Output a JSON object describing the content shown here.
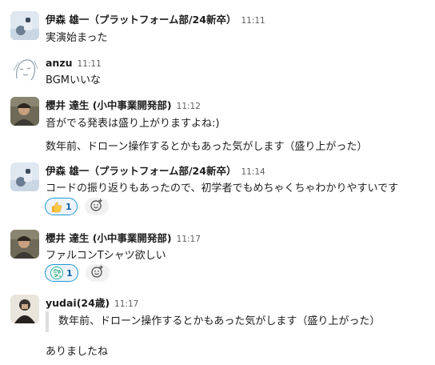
{
  "messages": [
    {
      "author": "伊森 雄一（プラットフォーム部/24新卒）",
      "time": "11:11",
      "avatar": "photo-avatar-ice",
      "lines": [
        "実演始まった"
      ]
    },
    {
      "author": "anzu",
      "time": "11:11",
      "avatar": "sketch-avatar",
      "lines": [
        "BGMいいな"
      ]
    },
    {
      "author": "櫻井 達生 (小中事業開発部)",
      "time": "11:12",
      "avatar": "photo-avatar-man",
      "lines": [
        "音がでる発表は盛り上がりますよね:)",
        "数年前、ドローン操作するとかもあった気がします（盛り上がった）"
      ]
    },
    {
      "author": "伊森 雄一（プラットフォーム部/24新卒）",
      "time": "11:14",
      "avatar": "photo-avatar-ice",
      "lines": [
        "コードの振り返りもあったので、初学者でもめちゃくちゃわかりやすいです"
      ],
      "reaction": {
        "emoji": "thumbs-up",
        "count": "1"
      }
    },
    {
      "author": "櫻井 達生 (小中事業開発部)",
      "time": "11:17",
      "avatar": "photo-avatar-man",
      "lines": [
        "ファルコンTシャツ欲しい"
      ],
      "reaction": {
        "emoji": "wakaru-sticker",
        "count": "1"
      }
    },
    {
      "author": "yudai(24歳)",
      "time": "11:17",
      "avatar": "photo-avatar-dark",
      "quote": "数年前、ドローン操作するとかもあった気がします（盛り上がった）",
      "lines": [
        "ありましたね"
      ]
    }
  ],
  "colors": {
    "reaction_border": "#1d9bd1",
    "reaction_bg": "#eef3fb",
    "reaction_count": "#1264a3",
    "timestamp": "#616061",
    "quote_bar": "#dddddd"
  }
}
